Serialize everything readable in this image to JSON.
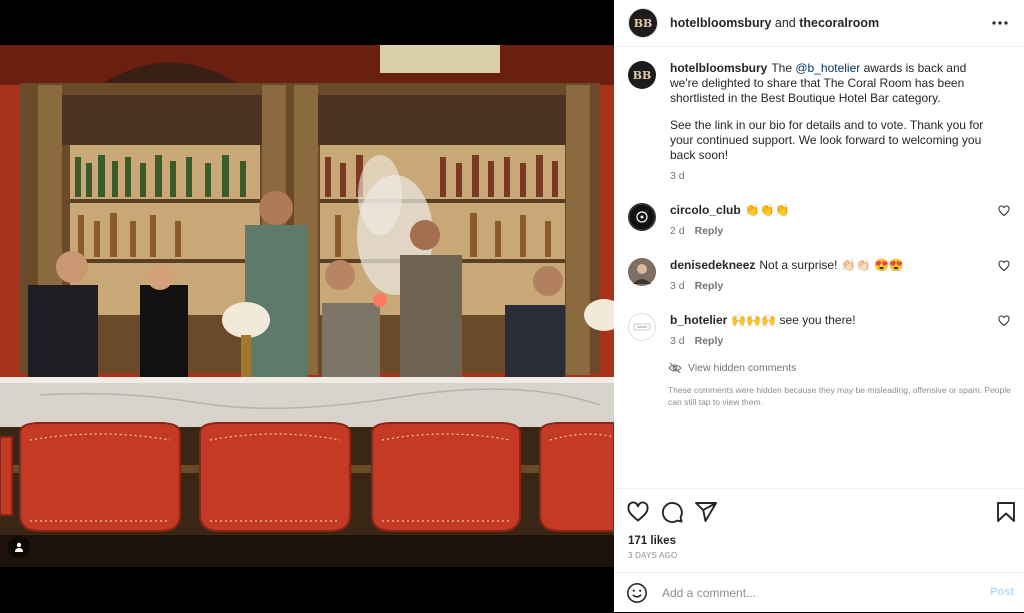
{
  "header": {
    "avatar_text": "BB",
    "username": "hotelbloomsbury",
    "joiner": " and ",
    "collaborator": "thecoralroom"
  },
  "caption": {
    "avatar_text": "BB",
    "username": "hotelbloomsbury",
    "text_before": "The ",
    "mention": "@b_hotelier",
    "text_after": " awards is back and we're delighted to share that The Coral Room has been shortlisted in the Best Boutique Hotel Bar category.",
    "paragraph2": "See the link in our bio for details and to vote. Thank you for your continued support. We look forward to welcoming you back soon!",
    "time": "3 d"
  },
  "comments": [
    {
      "avatar": "circolo-avatar",
      "username": "circolo_club",
      "text": "👏👏👏",
      "time": "2 d",
      "reply": "Reply"
    },
    {
      "avatar": "denise-avatar",
      "username": "denisedekneez",
      "text": "Not a surprise! 👏🏻👏🏻 😍😍",
      "time": "3 d",
      "reply": "Reply"
    },
    {
      "avatar": "b-hotelier-avatar",
      "username": "b_hotelier",
      "text": "🙌🙌🙌 see you there!",
      "time": "3 d",
      "reply": "Reply"
    }
  ],
  "hidden": {
    "link": "View hidden comments",
    "note": "These comments were hidden because they may be misleading, offensive or spam. People can still tap to view them."
  },
  "likes": "171 likes",
  "date": "3 DAYS AGO",
  "add_comment": {
    "placeholder": "Add a comment...",
    "post_label": "Post"
  },
  "colors": {
    "mention": "#00376b",
    "post_disabled": "#b3dbff",
    "wall": "#c8411f",
    "stool": "#c53a24"
  },
  "icons": [
    "more-icon",
    "heart-icon",
    "comment-icon",
    "share-icon",
    "bookmark-icon",
    "emoji-icon",
    "eye-off-icon",
    "tag-user-icon"
  ]
}
